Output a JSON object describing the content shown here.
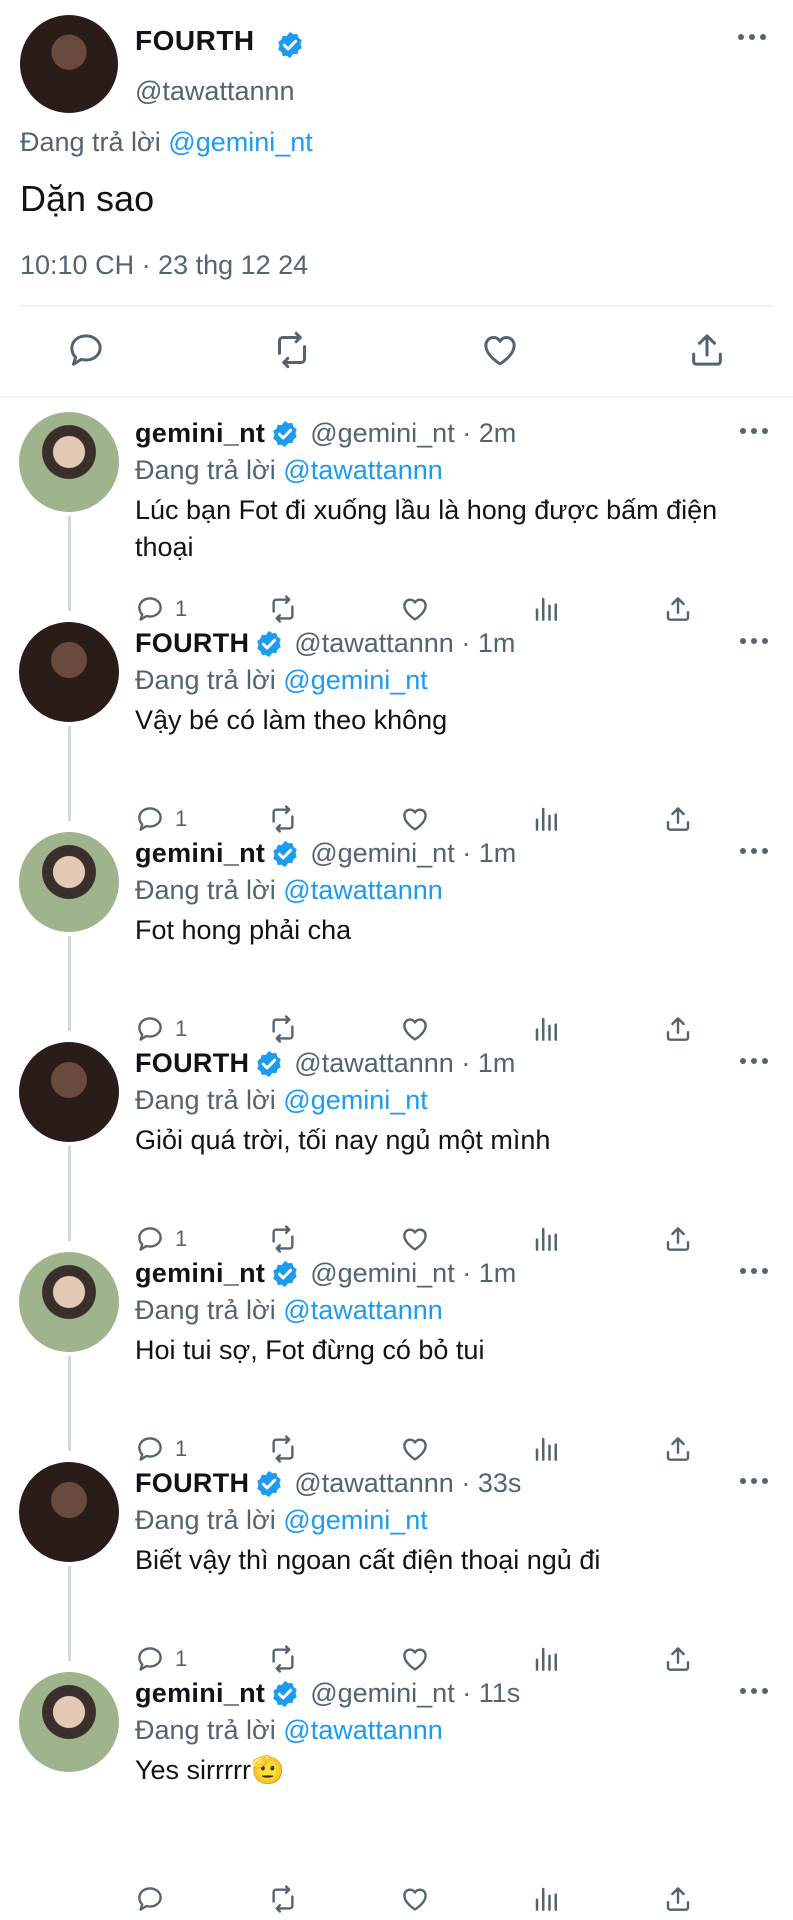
{
  "main_tweet": {
    "name": "FOURTH",
    "handle": "@tawattannn",
    "reply_prefix": "Đang trả lời",
    "reply_to": "@gemini_nt",
    "text": "Dặn sao",
    "meta": "10:10 CH · 23 thg 12 24",
    "icons": [
      "reply-icon",
      "retweet-icon",
      "like-icon",
      "share-icon"
    ]
  },
  "replies": [
    {
      "name": "gemini_nt",
      "handle": "@gemini_nt",
      "time": "2m",
      "reply_to": "@tawattannn",
      "text": "Lúc bạn Fot đi xuống lầu là hong được bấm điện thoại",
      "reply_count": "1",
      "avatar": "gemini"
    },
    {
      "name": "FOURTH",
      "handle": "@tawattannn",
      "time": "1m",
      "reply_to": "@gemini_nt",
      "text": "Vậy bé có làm theo không",
      "reply_count": "1",
      "avatar": "fourth"
    },
    {
      "name": "gemini_nt",
      "handle": "@gemini_nt",
      "time": "1m",
      "reply_to": "@tawattannn",
      "text": "Fot hong phải cha",
      "reply_count": "1",
      "avatar": "gemini"
    },
    {
      "name": "FOURTH",
      "handle": "@tawattannn",
      "time": "1m",
      "reply_to": "@gemini_nt",
      "text": "Giỏi quá trời, tối nay ngủ một mình",
      "reply_count": "1",
      "avatar": "fourth"
    },
    {
      "name": "gemini_nt",
      "handle": "@gemini_nt",
      "time": "1m",
      "reply_to": "@tawattannn",
      "text": "Hoi tui sợ, Fot đừng có bỏ tui",
      "reply_count": "1",
      "avatar": "gemini"
    },
    {
      "name": "FOURTH",
      "handle": "@tawattannn",
      "time": "33s",
      "reply_to": "@gemini_nt",
      "text": "Biết vậy thì ngoan cất điện thoại ngủ đi",
      "reply_count": "1",
      "avatar": "fourth"
    },
    {
      "name": "gemini_nt",
      "handle": "@gemini_nt",
      "time": "11s",
      "reply_to": "@tawattannn",
      "text": "Yes sirrrrr🫡",
      "reply_count": "",
      "avatar": "gemini"
    }
  ],
  "reply_prefix": "Đang trả lời",
  "colors": {
    "link": "#1d9bf0",
    "muted": "#536471",
    "verified": "#1d9bf0"
  }
}
